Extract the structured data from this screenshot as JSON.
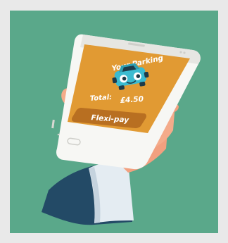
{
  "screen": {
    "title": "Your Parking",
    "total_label": "Total:",
    "total_amount": "£4.50",
    "button_label": "Flexi-pay"
  },
  "icons": {
    "car": "car-icon",
    "phone": "smartphone",
    "hand": "hand-holding-phone"
  },
  "colors": {
    "background": "#5aa88a",
    "screen": "#e19a33",
    "button": "#b86f21",
    "car": "#3bbbd0",
    "sleeve": "#234a66"
  }
}
